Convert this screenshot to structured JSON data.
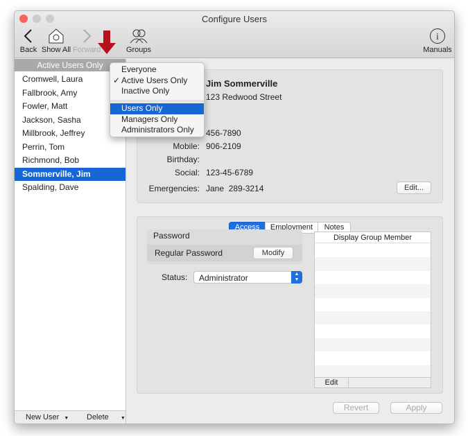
{
  "window": {
    "title": "Configure Users"
  },
  "toolbar": {
    "back": "Back",
    "show_all": "Show All",
    "forward": "Forward",
    "groups": "Groups",
    "manuals": "Manuals"
  },
  "sidebar": {
    "filter": "Active Users Only",
    "users": [
      "Cromwell, Laura",
      "Fallbrook, Amy",
      "Fowler, Matt",
      "Jackson, Sasha",
      "Millbrook, Jeffrey",
      "Perrin, Tom",
      "Richmond, Bob",
      "Sommerville, Jim",
      "Spalding, Dave"
    ],
    "selected": "Sommerville, Jim",
    "new_user": "New User",
    "delete": "Delete"
  },
  "filter_menu": {
    "items": [
      "Everyone",
      "Active Users Only",
      "Inactive Only",
      "Users Only",
      "Managers Only",
      "Administrators Only"
    ],
    "checked": "Active Users Only",
    "highlighted": "Users Only"
  },
  "user": {
    "name": "Jim Sommerville",
    "address": "123 Redwood Street",
    "phone": "456-7890",
    "mobile_label": "Mobile:",
    "mobile": "906-2109",
    "birthday_label": "Birthday:",
    "birthday": "",
    "social_label": "Social:",
    "social": "123-45-6789",
    "emergencies_label": "Emergencies:",
    "emergencies": "Jane  289-3214",
    "edit": "Edit..."
  },
  "tabs": {
    "items": [
      "Access",
      "Employment",
      "Notes"
    ],
    "active": "Access"
  },
  "access": {
    "password_label": "Password",
    "regular_password": "Regular Password",
    "modify": "Modify",
    "status_label": "Status:",
    "status": "Administrator"
  },
  "group_table": {
    "header": "Display Group Member",
    "edit": "Edit"
  },
  "footer": {
    "revert": "Revert",
    "apply": "Apply"
  },
  "colors": {
    "accent": "#1866d6",
    "arrow": "#b5121b"
  }
}
